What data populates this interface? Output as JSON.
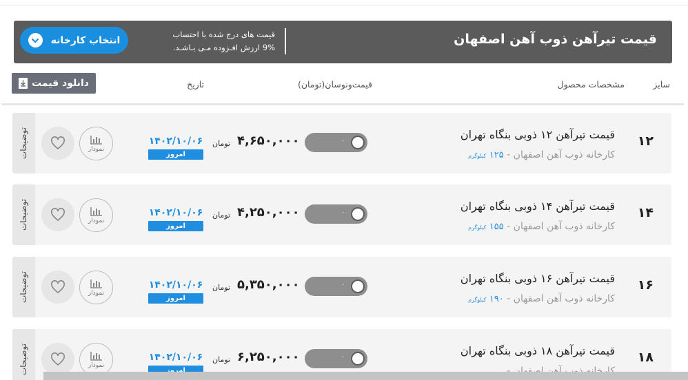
{
  "header": {
    "title": "قیمت تیرآهن ذوب آهن اصفهان",
    "vat_note_line1": "قیمت های درج شده با احتساب",
    "vat_note_line2": "9% ارزش افـزوده مـی بـاشـد.",
    "factory_button": "انتخاب کارخانه"
  },
  "columns": {
    "size": "سایز",
    "spec": "مشخصات محصول",
    "price": "قیمت‌ونوسان(تومان)",
    "date": "تاریخ",
    "download": "دانلود قیمت"
  },
  "icons": {
    "factory_chevron": "chevron-down-icon",
    "download": "file-download-icon",
    "chart": "bar-chart-icon",
    "favorite": "heart-icon"
  },
  "colors": {
    "header_bg": "#5b5b5b",
    "accent_blue": "#1a8fe0",
    "download_bg": "#6a6e78",
    "toggle_gray": "#8e8e8e",
    "row_bg": "#f4f4f4"
  },
  "rows": [
    {
      "size": "۱۲",
      "name": "قیمت تیرآهن ۱۲ ذوبی بنگاه تهران",
      "maker": "کارخانه ذوب آهن اصفهان -",
      "weight": "۱۲۵",
      "weight_unit": "کیلوگرم",
      "fluctuation": "۰",
      "price": "۴,۶۵۰,۰۰۰",
      "currency": "تومان",
      "date": "۱۴۰۲/۱۰/۰۶",
      "today": "امروز",
      "chart_label": "نمودار",
      "side_tab": "توضیحات"
    },
    {
      "size": "۱۴",
      "name": "قیمت تیرآهن ۱۴ ذوبی بنگاه تهران",
      "maker": "کارخانه ذوب آهن اصفهان -",
      "weight": "۱۵۵",
      "weight_unit": "کیلوگرم",
      "fluctuation": "۰",
      "price": "۴,۲۵۰,۰۰۰",
      "currency": "تومان",
      "date": "۱۴۰۲/۱۰/۰۶",
      "today": "امروز",
      "chart_label": "نمودار",
      "side_tab": "توضیحات"
    },
    {
      "size": "۱۶",
      "name": "قیمت تیرآهن ۱۶ ذوبی بنگاه تهران",
      "maker": "کارخانه ذوب آهن اصفهان -",
      "weight": "۱۹۰",
      "weight_unit": "کیلوگرم",
      "fluctuation": "۰",
      "price": "۵,۳۵۰,۰۰۰",
      "currency": "تومان",
      "date": "۱۴۰۲/۱۰/۰۶",
      "today": "امروز",
      "chart_label": "نمودار",
      "side_tab": "توضیحات"
    },
    {
      "size": "۱۸",
      "name": "قیمت تیرآهن ۱۸ ذوبی بنگاه تهران",
      "maker": "کارخانه ذوب آهن اصفهان -",
      "weight": "",
      "weight_unit": "",
      "fluctuation": "۰",
      "price": "۶,۲۵۰,۰۰۰",
      "currency": "تومان",
      "date": "۱۴۰۲/۱۰/۰۶",
      "today": "امروز",
      "chart_label": "نمودار",
      "side_tab": "توضیحات"
    }
  ]
}
